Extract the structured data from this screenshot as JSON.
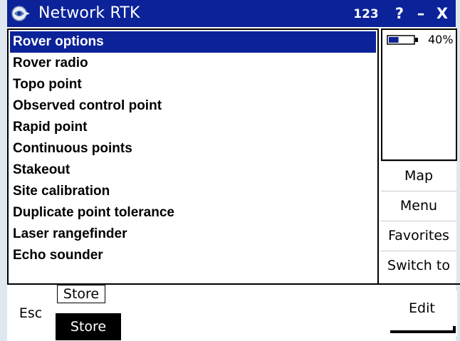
{
  "window": {
    "title": "Network RTK",
    "input_mode": "123",
    "help_label": "?",
    "minimize_label": "–",
    "close_label": "X"
  },
  "menu": {
    "items": [
      {
        "label": "Rover options",
        "selected": true
      },
      {
        "label": "Rover radio",
        "selected": false
      },
      {
        "label": "Topo point",
        "selected": false
      },
      {
        "label": "Observed control point",
        "selected": false
      },
      {
        "label": "Rapid point",
        "selected": false
      },
      {
        "label": "Continuous points",
        "selected": false
      },
      {
        "label": "Stakeout",
        "selected": false
      },
      {
        "label": "Site calibration",
        "selected": false
      },
      {
        "label": "Duplicate point tolerance",
        "selected": false
      },
      {
        "label": "Laser rangefinder",
        "selected": false
      },
      {
        "label": "Echo sounder",
        "selected": false
      }
    ]
  },
  "status": {
    "battery_percent": 40,
    "battery_text": "40%"
  },
  "side_buttons": {
    "map": "Map",
    "menu": "Menu",
    "favorites": "Favorites",
    "switch_to": "Switch to"
  },
  "bottom": {
    "esc": "Esc",
    "store_tooltip": "Store",
    "store": "Store",
    "edit": "Edit"
  },
  "colors": {
    "titlebar": "#0b2298",
    "selection": "#0b2298",
    "frame": "#dfe8ee"
  },
  "icons": {
    "app": "network-rtk-logo-icon",
    "battery": "battery-icon"
  }
}
